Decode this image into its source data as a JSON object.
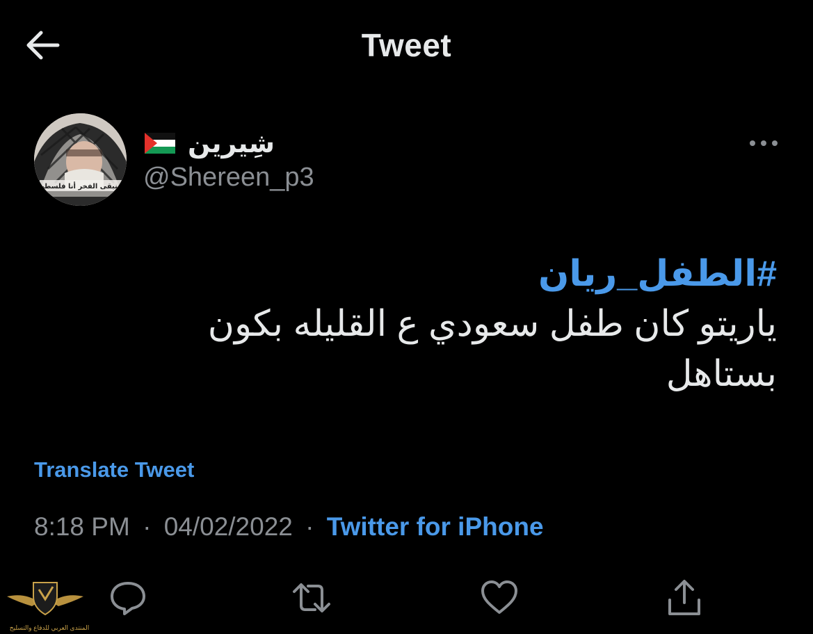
{
  "header": {
    "title": "Tweet",
    "back_icon": "arrow-left-icon"
  },
  "author": {
    "display_name": "شِيرين",
    "flag": "palestine-flag-emoji",
    "handle": "@Shereen_p3",
    "avatar_caption": "سنبقى الفخر أنا فلسطين"
  },
  "tweet": {
    "hashtag": "#الطفل_ريان",
    "text": "ياريتو كان طفل سعودي ع القليله بكون بستاهل"
  },
  "translate_label": "Translate Tweet",
  "meta": {
    "time": "8:18 PM",
    "separator": "·",
    "date": "04/02/2022",
    "source": "Twitter for iPhone"
  },
  "actions": {
    "reply_icon": "reply-icon",
    "retweet_icon": "retweet-icon",
    "like_icon": "heart-icon",
    "share_icon": "share-icon",
    "more_icon": "more-horizontal-icon"
  },
  "watermark": {
    "text": "المنتدى العربي للدفاع والتسليح"
  },
  "colors": {
    "background": "#000000",
    "text": "#e7e9ea",
    "secondary": "#8b8f94",
    "accent": "#4a99e9"
  }
}
